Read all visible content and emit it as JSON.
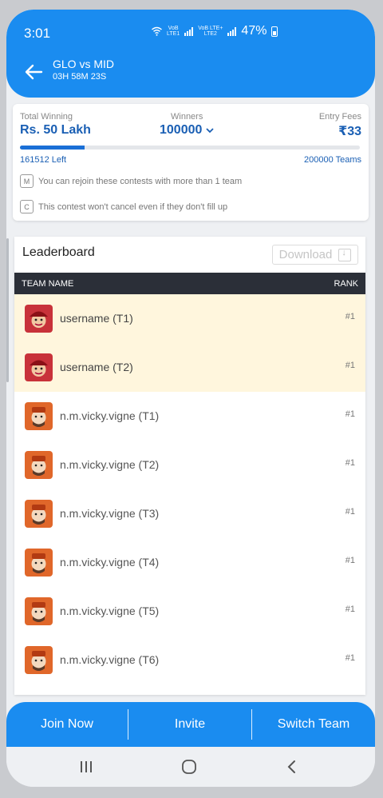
{
  "status_bar": {
    "time": "3:01",
    "net1_top": "VoB",
    "net1_bottom": "LTE1",
    "net2_top": "VoB LTE+",
    "net2_bottom": "LTE2",
    "battery": "47%"
  },
  "header": {
    "title": "GLO vs MID",
    "timer": "03H 58M 23S",
    "color": "#1a8cf0"
  },
  "contest": {
    "total_winning_label": "Total Winning",
    "total_winning": "Rs. 50 Lakh",
    "winners_label": "Winners",
    "winners": "100000",
    "entry_fees_label": "Entry Fees",
    "entry_fees": "₹33",
    "spots_left": "161512 Left",
    "total_teams": "200000 Teams",
    "fill_fraction": 0.19,
    "rule_m_badge": "M",
    "rule_m": "You can rejoin these contests with more than 1 team",
    "rule_c_badge": "C",
    "rule_c": "This contest won't cancel even if they don't fill up"
  },
  "leaderboard": {
    "title": "Leaderboard",
    "download_label": "Download",
    "col_team": "TEAM NAME",
    "col_rank": "RANK",
    "rows": [
      {
        "name": "username (T1)",
        "rank": "#1",
        "mine": true
      },
      {
        "name": "username (T2)",
        "rank": "#1",
        "mine": true
      },
      {
        "name": "n.m.vicky.vigne (T1)",
        "rank": "#1",
        "mine": false
      },
      {
        "name": "n.m.vicky.vigne (T2)",
        "rank": "#1",
        "mine": false
      },
      {
        "name": "n.m.vicky.vigne (T3)",
        "rank": "#1",
        "mine": false
      },
      {
        "name": "n.m.vicky.vigne (T4)",
        "rank": "#1",
        "mine": false
      },
      {
        "name": "n.m.vicky.vigne (T5)",
        "rank": "#1",
        "mine": false
      },
      {
        "name": "n.m.vicky.vigne (T6)",
        "rank": "#1",
        "mine": false
      }
    ]
  },
  "actions": {
    "join": "Join Now",
    "invite": "Invite",
    "switch": "Switch Team"
  },
  "icons": {
    "back": "arrow-left-icon",
    "chevron": "chevron-down-icon",
    "download": "download-icon",
    "nav_recent": "recent-apps-icon",
    "nav_home": "home-icon",
    "nav_back": "back-icon"
  }
}
